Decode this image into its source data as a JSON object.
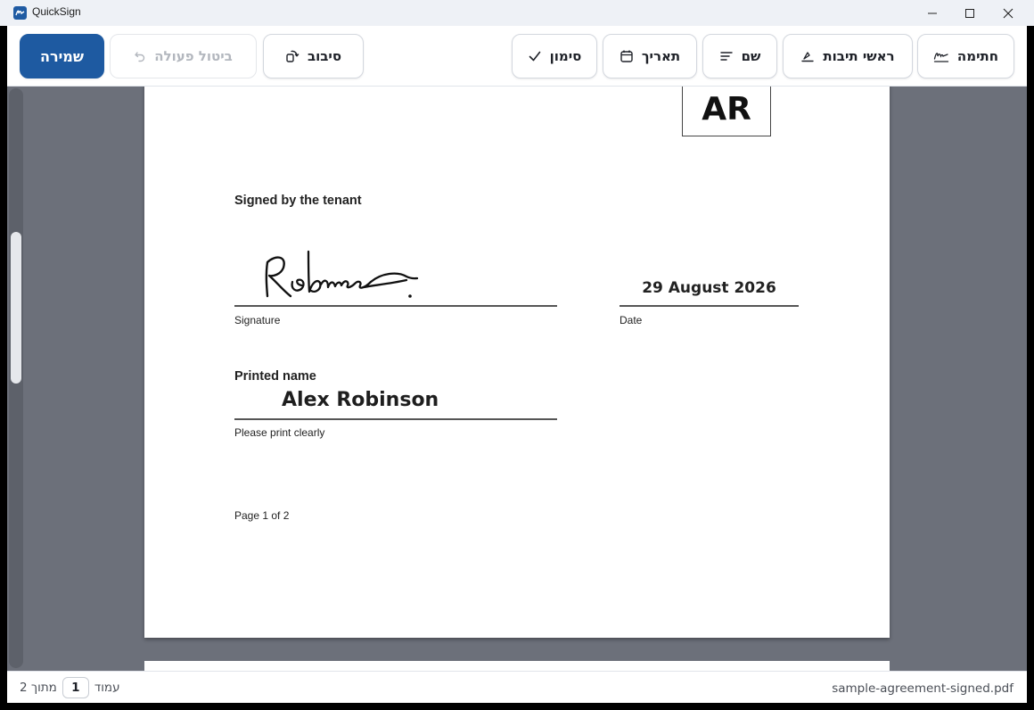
{
  "window": {
    "title": "QuickSign"
  },
  "toolbar": {
    "save_label": "שמירה",
    "undo_label": "ביטול פעולה",
    "rotate_label": "סיבוב",
    "check_label": "סימון",
    "date_label": "תאריך",
    "name_label": "שם",
    "initials_label": "ראשי תיבות",
    "signature_label": "חתימה",
    "undo_enabled": false,
    "accent_color": "#1e5aa1"
  },
  "document": {
    "initials": "AR",
    "signed_by": "Signed by the tenant",
    "signature_label": "Signature",
    "date_value": "29 August 2026",
    "date_label": "Date",
    "printed_name_label": "Printed name",
    "printed_name_value": "Alex Robinson",
    "print_hint": "Please print clearly",
    "page_label": "Page 1 of 2"
  },
  "statusbar": {
    "filename": "sample-agreement-signed.pdf",
    "page_word": "עמוד",
    "current_page": "1",
    "of_total": "מתוך 2"
  },
  "icons": {
    "app": "quicksign-icon",
    "minimize": "minimize-icon",
    "maximize": "maximize-icon",
    "close": "close-icon",
    "undo": "undo-icon",
    "rotate": "rotate-icon",
    "check": "check-icon",
    "date": "calendar-icon",
    "name": "text-lines-icon",
    "initials": "initials-pen-icon",
    "signature": "signature-icon"
  }
}
